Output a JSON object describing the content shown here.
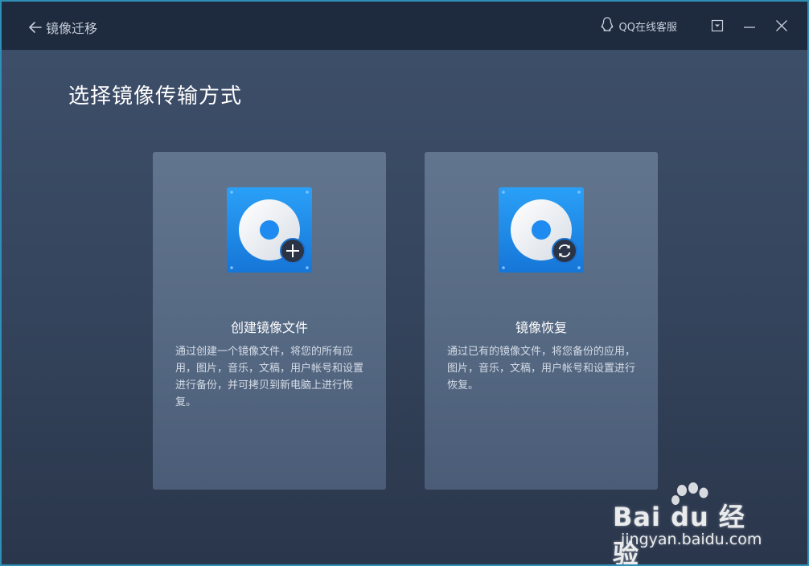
{
  "header": {
    "back_label": "镜像迁移",
    "qq_service": "QQ在线客服"
  },
  "page_title": "选择镜像传输方式",
  "cards": [
    {
      "title": "创建镜像文件",
      "description": "通过创建一个镜像文件，将您的所有应用，图片，音乐，文稿，用户帐号和设置进行备份，并可拷贝到新电脑上进行恢复。",
      "icon": "disk-add-icon"
    },
    {
      "title": "镜像恢复",
      "description": "通过已有的镜像文件，将您备份的应用，图片，音乐，文稿，用户帐号和设置进行恢复。",
      "icon": "disk-restore-icon"
    }
  ],
  "watermark": {
    "brand": "Bai du 经验",
    "url": "jingyan.baidu.com"
  },
  "colors": {
    "accent_border": "#2f8fb6",
    "titlebar": "#1e2a3e",
    "icon_blue": "#1e8bf0"
  }
}
